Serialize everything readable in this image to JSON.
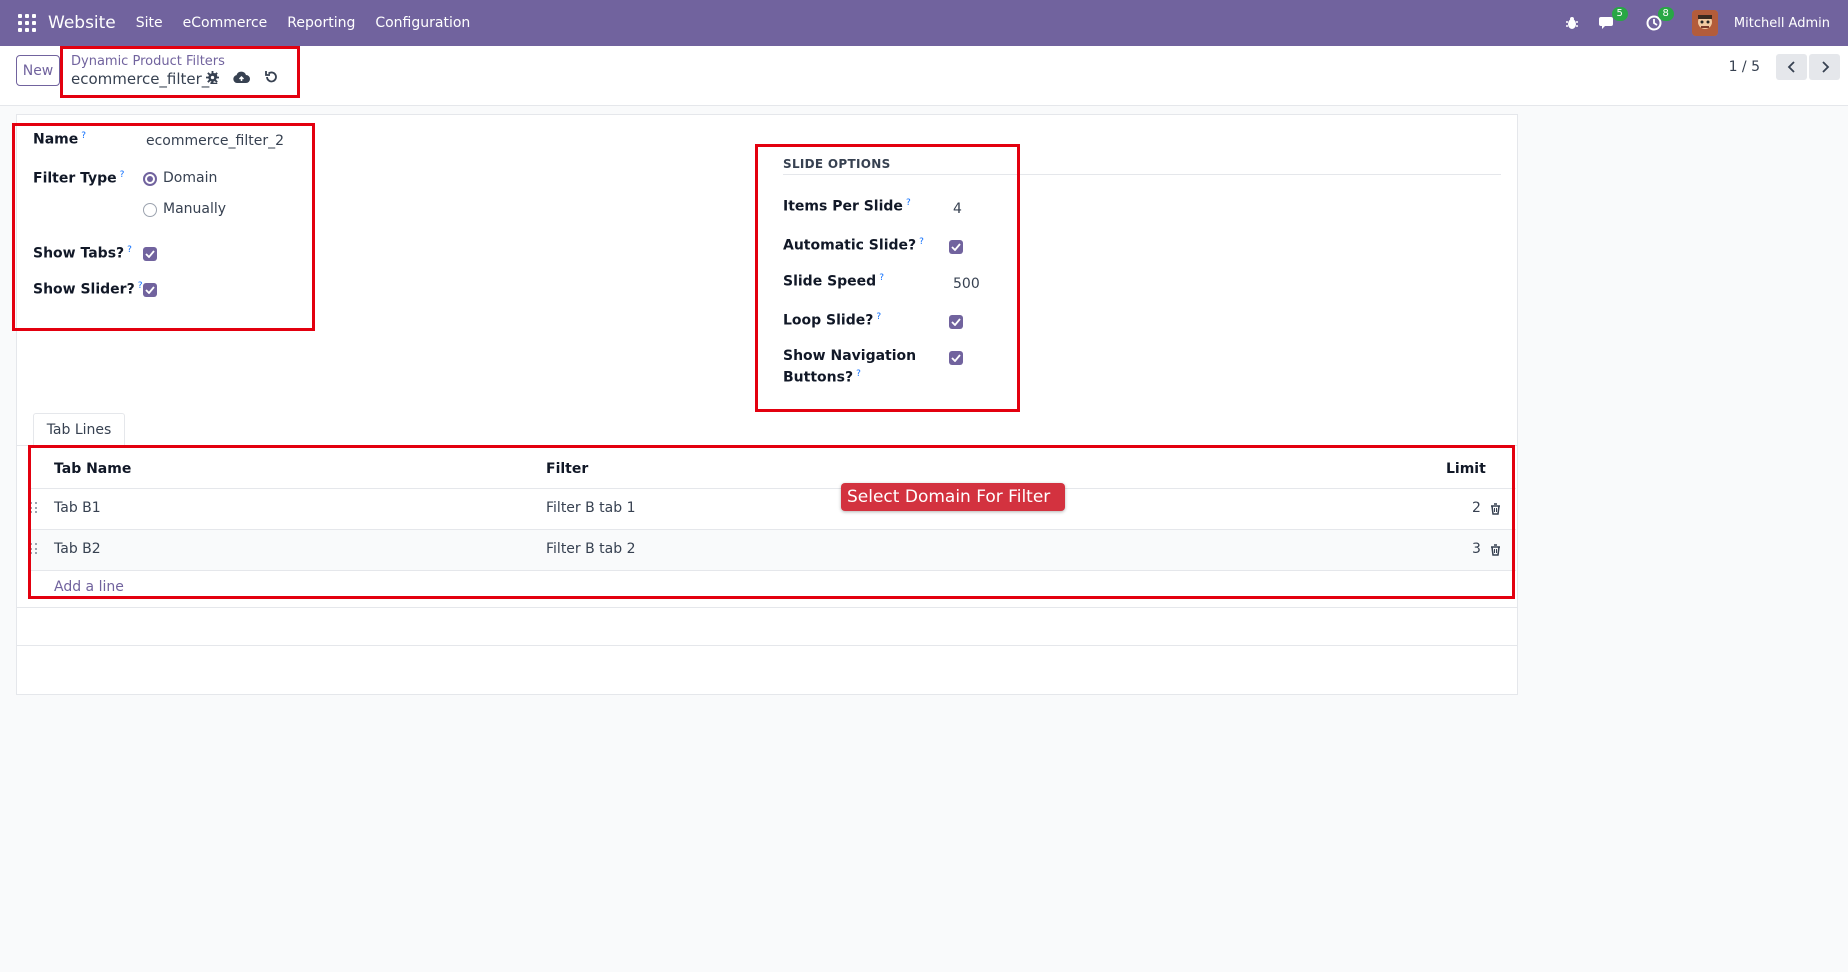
{
  "navbar": {
    "app_name": "Website",
    "menus": [
      "Site",
      "eCommerce",
      "Reporting",
      "Configuration"
    ],
    "messages_count": "5",
    "activities_count": "8",
    "user_name": "Mitchell Admin",
    "icons": [
      "apps-grid-icon",
      "bug-icon",
      "chat-icon",
      "clock-icon"
    ],
    "accent_color": "#71639e"
  },
  "control_panel": {
    "new_label": "New",
    "breadcrumb": "Dynamic Product Filters",
    "record_name": "ecommerce_filter_2",
    "pager": "1 / 5"
  },
  "form": {
    "name_label": "Name",
    "name_value": "ecommerce_filter_2",
    "filter_type_label": "Filter Type",
    "filter_type_options": [
      "Domain",
      "Manually"
    ],
    "filter_type_selected": "Domain",
    "show_tabs_label": "Show Tabs?",
    "show_tabs_checked": true,
    "show_slider_label": "Show Slider?",
    "show_slider_checked": true,
    "help_marker": "?"
  },
  "slide_options": {
    "title": "SLIDE OPTIONS",
    "items_per_slide_label": "Items Per Slide",
    "items_per_slide": "4",
    "automatic_slide_label": "Automatic Slide?",
    "automatic_slide_checked": true,
    "slide_speed_label": "Slide Speed",
    "slide_speed": "500",
    "loop_slide_label": "Loop Slide?",
    "loop_slide_checked": true,
    "show_nav_label_1": "Show Navigation",
    "show_nav_label_2": "Buttons?",
    "show_nav_checked": true
  },
  "tabs": {
    "active": "Tab Lines"
  },
  "tab_lines": {
    "headers": {
      "tab_name": "Tab Name",
      "filter": "Filter",
      "limit": "Limit"
    },
    "rows": [
      {
        "tab_name": "Tab B1",
        "filter": "Filter B tab 1",
        "limit": "2"
      },
      {
        "tab_name": "Tab B2",
        "filter": "Filter B tab 2",
        "limit": "3"
      }
    ],
    "add_line": "Add a line"
  },
  "annotation": {
    "tooltip": "Select Domain For Filter"
  }
}
